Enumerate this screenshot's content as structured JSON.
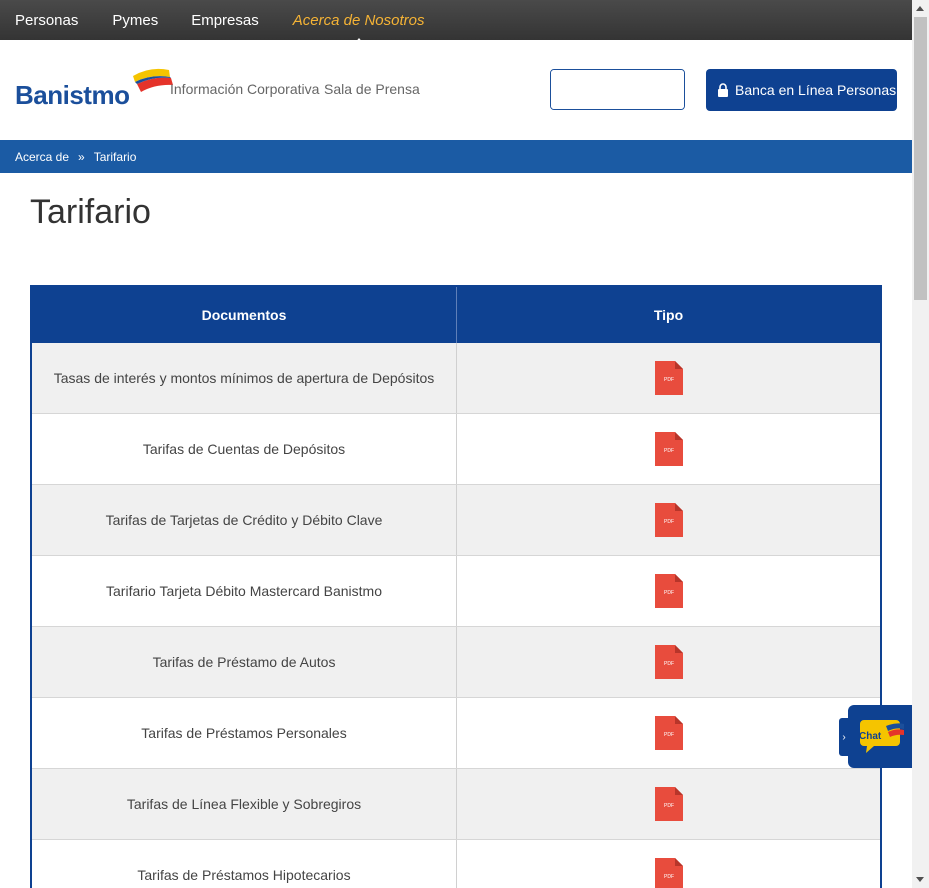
{
  "topnav": {
    "items": [
      "Personas",
      "Pymes",
      "Empresas",
      "Acerca de Nosotros"
    ]
  },
  "brand": {
    "logo_text": "Banistmo"
  },
  "header": {
    "links": [
      "Información Corporativa",
      "Sala de Prensa"
    ],
    "search_placeholder": "",
    "banking_button": "Banca en Línea Personas"
  },
  "breadcrumb": {
    "items": [
      "Acerca de",
      "Tarifario"
    ],
    "separator": "»"
  },
  "page": {
    "title": "Tarifario"
  },
  "table": {
    "headers": [
      "Documentos",
      "Tipo"
    ],
    "rows": [
      {
        "doc": "Tasas de interés y montos mínimos de apertura de Depósitos",
        "type": "PDF"
      },
      {
        "doc": "Tarifas de Cuentas de Depósitos",
        "type": "PDF"
      },
      {
        "doc": "Tarifas de Tarjetas de Crédito y Débito Clave",
        "type": "PDF"
      },
      {
        "doc": "Tarifario Tarjeta Débito Mastercard Banistmo",
        "type": "PDF"
      },
      {
        "doc": "Tarifas de Préstamo de Autos",
        "type": "PDF"
      },
      {
        "doc": "Tarifas de Préstamos Personales",
        "type": "PDF"
      },
      {
        "doc": "Tarifas de Línea Flexible y Sobregiros",
        "type": "PDF"
      },
      {
        "doc": "Tarifas de Préstamos Hipotecarios",
        "type": "PDF"
      }
    ]
  },
  "chat": {
    "label": "Chat",
    "toggle": "›"
  },
  "colors": {
    "primary": "#0e4191",
    "breadcrumb": "#1b5ba4",
    "accent": "#f5b335",
    "pdf": "#e84c3d"
  },
  "icons": {
    "search": "search-icon",
    "lock": "lock-icon",
    "pdf": "pdf-file-icon",
    "chat": "chat-bubble-icon"
  }
}
